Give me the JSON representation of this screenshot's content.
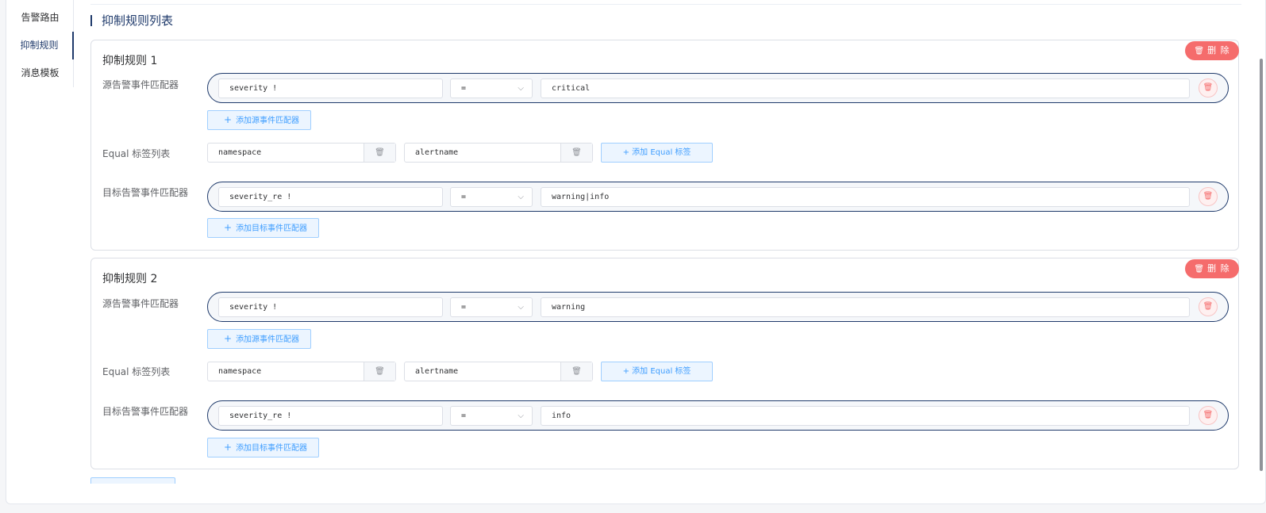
{
  "nav": {
    "items": [
      {
        "label": "告警路由"
      },
      {
        "label": "抑制规则"
      },
      {
        "label": "消息模板"
      }
    ]
  },
  "section": {
    "title": "抑制规则列表"
  },
  "labels": {
    "source_matcher": "源告警事件匹配器",
    "equal_list": "Equal 标签列表",
    "target_matcher": "目标告警事件匹配器",
    "add_source": "添加源事件匹配器",
    "add_equal": "添加 Equal 标签",
    "add_target": "添加目标事件匹配器",
    "delete": "删 除"
  },
  "rules": [
    {
      "title": "抑制规则 1",
      "source": {
        "name": "severity !",
        "op": "=",
        "value": "critical"
      },
      "equal": [
        "namespace",
        "alertname"
      ],
      "target": {
        "name": "severity_re !",
        "op": "=",
        "value": "warning|info"
      }
    },
    {
      "title": "抑制规则 2",
      "source": {
        "name": "severity !",
        "op": "=",
        "value": "warning"
      },
      "equal": [
        "namespace",
        "alertname"
      ],
      "target": {
        "name": "severity_re !",
        "op": "=",
        "value": "info"
      }
    }
  ],
  "icons": {
    "trash": "trash-icon",
    "plus": "plus-icon",
    "chevron": "chevron-down-icon"
  }
}
